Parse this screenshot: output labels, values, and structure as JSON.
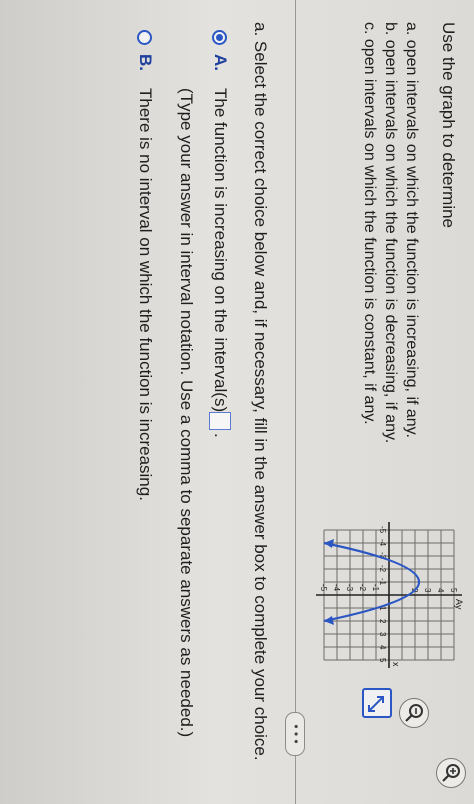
{
  "question": {
    "title": "Use the graph to determine",
    "parts": [
      "a. open intervals on which the function is increasing, if any.",
      "b. open intervals on which the function is decreasing, if any.",
      "c. open intervals on which the function is constant, if any."
    ]
  },
  "graph": {
    "axis_y_label": "Ay",
    "axis_x_label": "x",
    "x_ticks": [
      "-5",
      "-4",
      "-3",
      "-2",
      "-1",
      "1",
      "2",
      "3",
      "4",
      "5"
    ],
    "y_ticks": [
      "5",
      "4",
      "3",
      "2",
      "-1",
      "-2",
      "-3",
      "-4",
      "-5"
    ],
    "curve_color": "#2b57c4",
    "vertex": [
      -1,
      4
    ],
    "endpoints": [
      [
        -4,
        -5
      ],
      [
        2,
        -5
      ]
    ]
  },
  "more_button": {
    "label": "• • •"
  },
  "part_a": {
    "prompt": "a. Select the correct choice below and, if necessary, fill in the answer box to complete your choice.",
    "choices": [
      {
        "letter": "A.",
        "text": "The function is increasing on the interval(s)",
        "hint": "(Type your answer in interval notation. Use a comma to separate answers as needed.)",
        "selected": true,
        "answer_value": ""
      },
      {
        "letter": "B.",
        "text": "There is no interval on which the function is increasing.",
        "selected": false
      }
    ]
  },
  "tools": [
    "zoom-in-icon",
    "zoom-out-icon",
    "expand-icon"
  ],
  "colors": {
    "accent": "#2b57c4",
    "text": "#1e1e1e"
  }
}
